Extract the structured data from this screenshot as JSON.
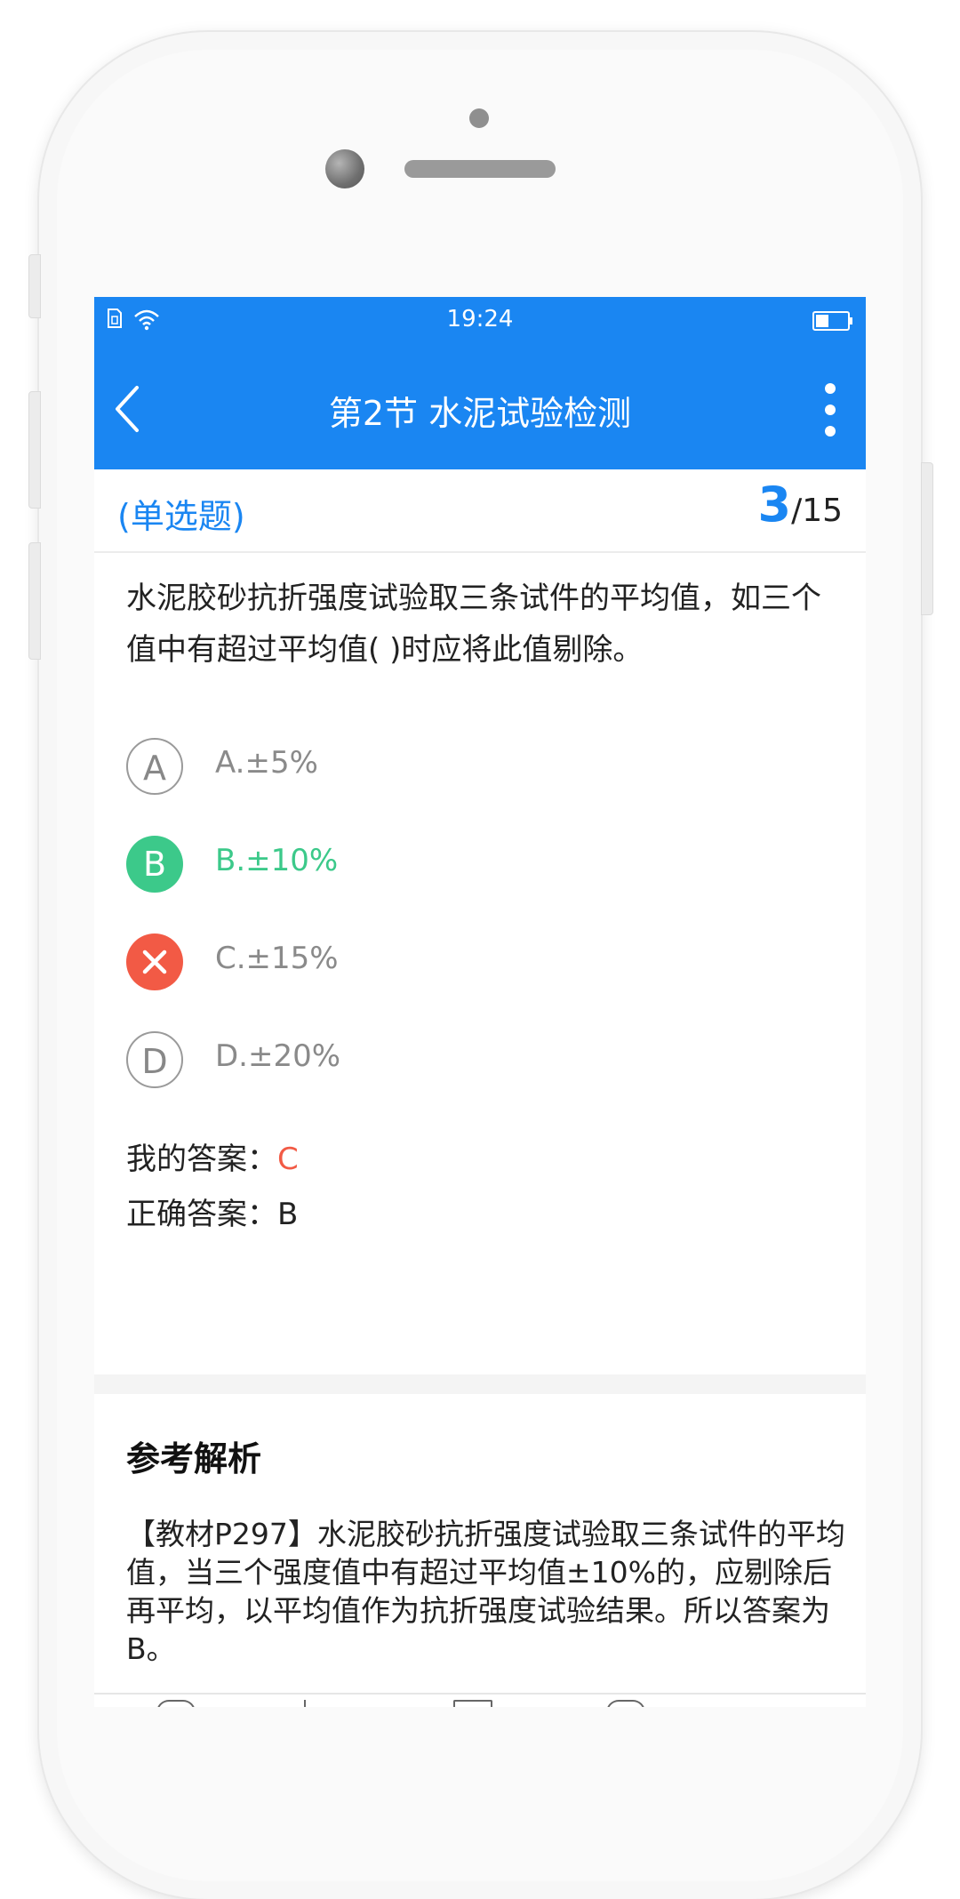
{
  "status_bar": {
    "time": "19:24"
  },
  "nav": {
    "title": "第2节 水泥试验检测"
  },
  "question_header": {
    "type": "(单选题)",
    "current": "3",
    "total": "/15"
  },
  "question": {
    "text": "水泥胶砂抗折强度试验取三条试件的平均值，如三个值中有超过平均值( )时应将此值剔除。"
  },
  "options": [
    {
      "letter": "A",
      "text": "A.±5%",
      "state": "normal"
    },
    {
      "letter": "B",
      "text": "B.±10%",
      "state": "correct"
    },
    {
      "letter": "C",
      "text": "C.±15%",
      "state": "wrong"
    },
    {
      "letter": "D",
      "text": "D.±20%",
      "state": "normal"
    }
  ],
  "answers": {
    "my_label": "我的答案：",
    "my_value": "C",
    "correct_label": "正确答案：",
    "correct_value": "B"
  },
  "analysis": {
    "title": "参考解析",
    "text": "【教材P297】水泥胶砂抗折强度试验取三条试件的平均值，当三个强度值中有超过平均值±10%的，应剔除后再平均，以平均值作为抗折强度试验结果。所以答案为B。"
  },
  "colors": {
    "accent": "#1a86f2",
    "correct": "#3cc98a",
    "wrong": "#f25a45"
  },
  "icons": [
    "sim-card-icon",
    "wifi-icon",
    "battery-icon",
    "back-arrow-icon",
    "more-vertical-icon",
    "close-x-icon"
  ]
}
